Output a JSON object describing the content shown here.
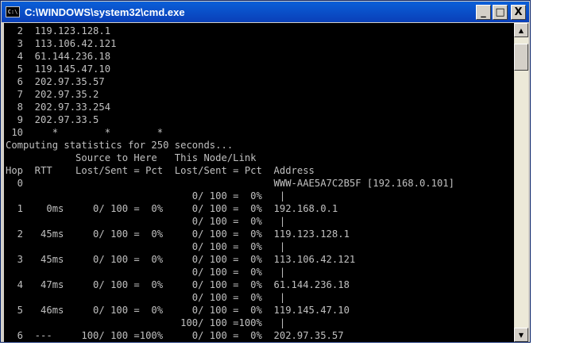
{
  "window": {
    "title": "C:\\WINDOWS\\system32\\cmd.exe",
    "icon_label": "C:\\",
    "minimize_label": "_",
    "maximize_label": "□",
    "close_label": "X"
  },
  "scrollbar": {
    "up_label": "▲",
    "down_label": "▼"
  },
  "console": {
    "lines": [
      "  2  119.123.128.1",
      "  3  113.106.42.121",
      "  4  61.144.236.18",
      "  5  119.145.47.10",
      "  6  202.97.35.57",
      "  7  202.97.35.2",
      "  8  202.97.33.254",
      "  9  202.97.33.5",
      " 10     *        *        *",
      "Computing statistics for 250 seconds...",
      "            Source to Here   This Node/Link",
      "Hop  RTT    Lost/Sent = Pct  Lost/Sent = Pct  Address",
      "  0                                           WWW-AAE5A7C2B5F [192.168.0.101]",
      "                                0/ 100 =  0%   |",
      "  1    0ms     0/ 100 =  0%     0/ 100 =  0%  192.168.0.1",
      "                                0/ 100 =  0%   |",
      "  2   45ms     0/ 100 =  0%     0/ 100 =  0%  119.123.128.1",
      "                                0/ 100 =  0%   |",
      "  3   45ms     0/ 100 =  0%     0/ 100 =  0%  113.106.42.121",
      "                                0/ 100 =  0%   |",
      "  4   47ms     0/ 100 =  0%     0/ 100 =  0%  61.144.236.18",
      "                                0/ 100 =  0%   |",
      "  5   46ms     0/ 100 =  0%     0/ 100 =  0%  119.145.47.10",
      "                              100/ 100 =100%   |",
      "  6  ---     100/ 100 =100%     0/ 100 =  0%  202.97.35.57"
    ]
  }
}
